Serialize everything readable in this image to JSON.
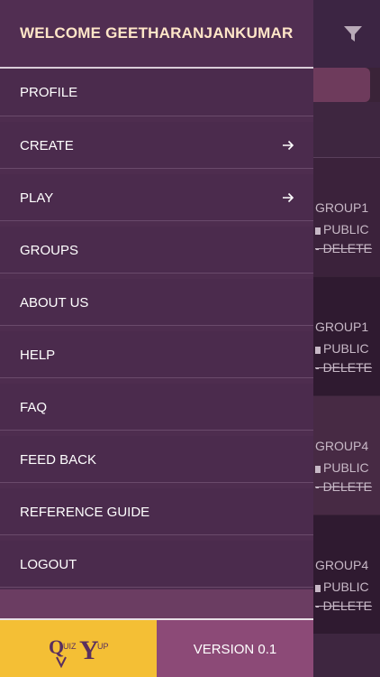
{
  "colors": {
    "drawer_bg": "#4e2d4f",
    "welcome_text": "#ffe6c8",
    "logo_bg": "#f4bf35",
    "version_bg": "#8c4a77",
    "accent_search": "#6e3b5c"
  },
  "background": {
    "filter_icon": "filter-icon",
    "cards": [
      {
        "group": "GROUP1",
        "visibility": "PUBLIC",
        "action": "DELETE"
      },
      {
        "group": "GROUP1",
        "visibility": "PUBLIC",
        "action": "DELETE"
      },
      {
        "group": "GROUP4",
        "visibility": "PUBLIC",
        "action": "DELETE"
      },
      {
        "group": "GROUP4",
        "visibility": "PUBLIC",
        "action": "DELETE"
      }
    ],
    "delete_prefix": "- "
  },
  "drawer": {
    "welcome": "WELCOME GEETHARANJANKUMAR",
    "items": [
      {
        "label": "PROFILE"
      },
      {
        "label": "CREATE",
        "icon": "arrow-right-icon"
      },
      {
        "label": "PLAY",
        "icon": "arrow-right-icon"
      },
      {
        "label": "GROUPS"
      },
      {
        "label": "ABOUT US"
      },
      {
        "label": "HELP"
      },
      {
        "label": "FAQ"
      },
      {
        "label": "FEED BACK"
      },
      {
        "label": "REFERENCE GUIDE"
      },
      {
        "label": "LOGOUT"
      }
    ],
    "logo_text": "QuizYup",
    "version": "VERSION 0.1"
  }
}
